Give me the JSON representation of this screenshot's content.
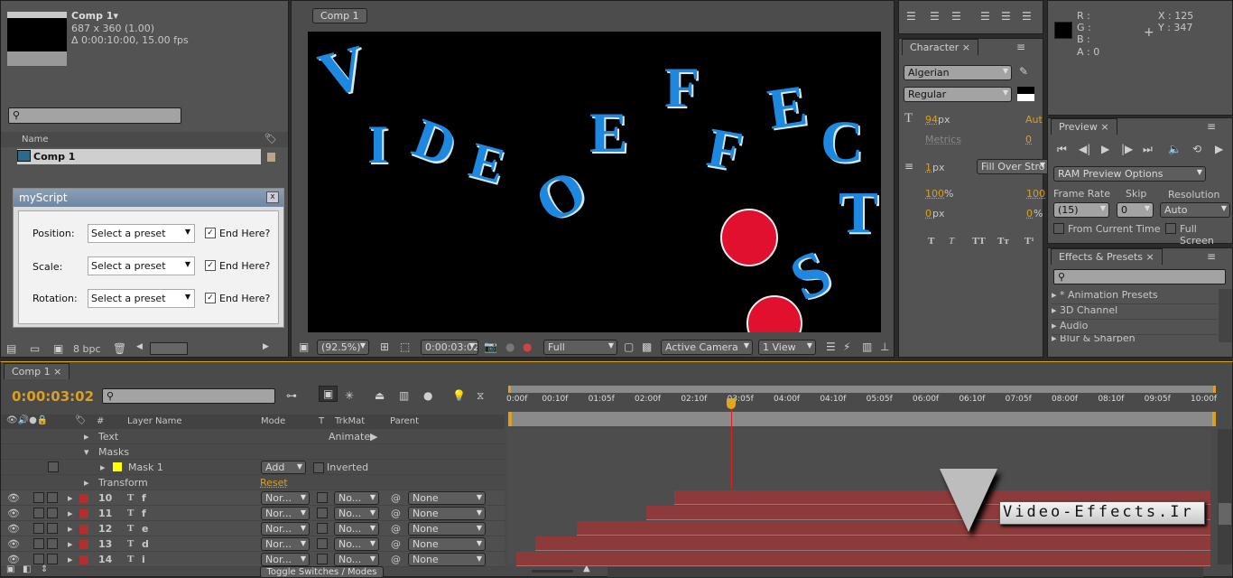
{
  "project": {
    "comp_name": "Comp 1▾",
    "dimensions": "687 x 360 (1.00)",
    "duration": "Δ 0:00:10:00, 15.00 fps",
    "column_name": "Name",
    "item": "Comp 1",
    "bpc": "8 bpc"
  },
  "script_dialog": {
    "title": "myScript",
    "close": "x",
    "rows": [
      {
        "label": "Position:",
        "select": "Select a preset",
        "checkbox": "End Here?",
        "checked": true
      },
      {
        "label": "Scale:",
        "select": "Select a preset",
        "checkbox": "End Here?",
        "checked": true
      },
      {
        "label": "Rotation:",
        "select": "Select a preset",
        "checkbox": "End Here?",
        "checked": true
      }
    ]
  },
  "viewer": {
    "tab": "Comp 1",
    "zoom": "(92.5%)",
    "timecode": "0:00:03:02",
    "resolution": "Full",
    "camera": "Active Camera",
    "views": "1 View",
    "canvas": {
      "letters": [
        "V",
        "I",
        "D",
        "E",
        "O",
        "E",
        "F",
        "F",
        "E",
        "C",
        "T",
        "S"
      ],
      "text_color": "#1e88e0",
      "circle_color": "#e0102e"
    }
  },
  "character": {
    "tab": "Character",
    "font": "Algerian",
    "style": "Regular",
    "size": "94",
    "size_unit": "px",
    "leading": "Aut",
    "kerning": "Metrics",
    "tracking": "0",
    "stroke": "1",
    "stroke_unit": "px",
    "stroke_mode": "Fill Over Stro",
    "vscale": "100",
    "vscale_unit": "%",
    "hscale": "100",
    "baseline": "0",
    "baseline_unit": "px",
    "tsume": "0",
    "tsume_unit": "%",
    "styles": [
      "T",
      "T",
      "TT",
      "Tт",
      "T¹"
    ]
  },
  "info": {
    "r": "R :",
    "g": "G :",
    "b": "B :",
    "a": "A : 0",
    "x": "X : 125",
    "y": "Y : 347"
  },
  "preview": {
    "tab": "Preview",
    "ram": "RAM Preview Options",
    "frame_rate_label": "Frame Rate",
    "skip_label": "Skip",
    "resolution_label": "Resolution",
    "frame_rate": "(15)",
    "skip": "0",
    "resolution": "Auto",
    "from_current": "From Current Time",
    "full_screen": "Full Screen"
  },
  "effects": {
    "tab": "Effects & Presets",
    "items": [
      "* Animation Presets",
      "3D Channel",
      "Audio",
      "Blur & Sharpen"
    ]
  },
  "timeline": {
    "tab": "Comp 1",
    "time": "0:00:03:02",
    "columns": {
      "layer_name": "Layer Name",
      "mode": "Mode",
      "t": "T",
      "trkmat": "TrkMat",
      "parent": "Parent",
      "num": "#"
    },
    "props": {
      "text": "Text",
      "animate": "Animate:",
      "masks": "Masks",
      "mask1": "Mask 1",
      "add": "Add",
      "inverted": "Inverted",
      "transform": "Transform",
      "reset": "Reset"
    },
    "layers": [
      {
        "num": "10",
        "name": "f",
        "mode": "Nor...",
        "trkmat": "No...",
        "parent": "None",
        "start": "02:05f"
      },
      {
        "num": "11",
        "name": "f",
        "mode": "Nor...",
        "trkmat": "No...",
        "parent": "None",
        "start": "01:14f"
      },
      {
        "num": "12",
        "name": "e",
        "mode": "Nor...",
        "trkmat": "No...",
        "parent": "None",
        "start": "00:14f"
      },
      {
        "num": "13",
        "name": "d",
        "mode": "Nor...",
        "trkmat": "No...",
        "parent": "None",
        "start": "00:05f"
      },
      {
        "num": "14",
        "name": "i",
        "mode": "Nor...",
        "trkmat": "No...",
        "parent": "None",
        "start": "00:01f"
      }
    ],
    "ruler": [
      "0:00f",
      "00:10f",
      "01:05f",
      "02:00f",
      "02:10f",
      "03:05f",
      "04:00f",
      "04:10f",
      "05:05f",
      "06:00f",
      "06:10f",
      "07:05f",
      "08:00f",
      "08:10f",
      "09:05f",
      "10:00f"
    ],
    "toggle": "Toggle Switches / Modes",
    "bar_color": "#8c3a3a",
    "playhead_color": "#e02020"
  },
  "watermark": "Video-Effects.Ir"
}
